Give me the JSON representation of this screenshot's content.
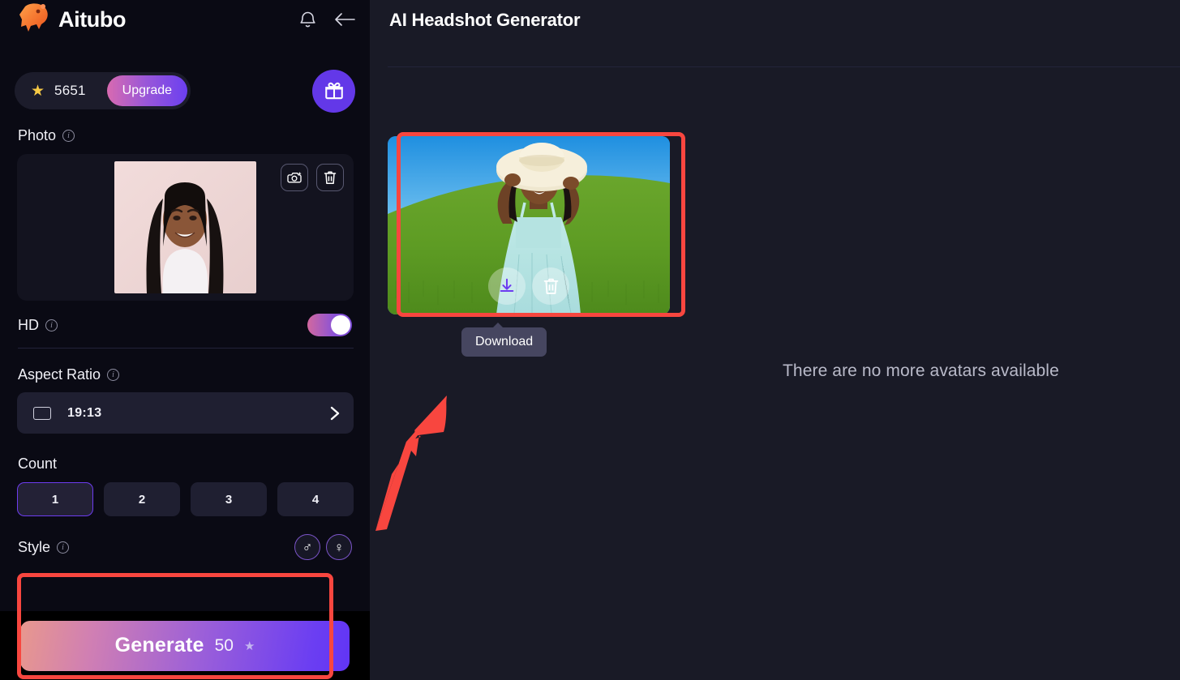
{
  "sidebar": {
    "brand": "Aitubo",
    "logo_icon": "capybara-logo",
    "header_icons": [
      {
        "name": "notification-bell-icon",
        "label": "Notifications"
      },
      {
        "name": "back-arrow-icon",
        "label": "Back"
      }
    ],
    "credits": {
      "star_icon": "star-icon",
      "amount": "5651",
      "upgrade_label": "Upgrade"
    },
    "gift": {
      "icon": "gift-icon",
      "label": "Gift"
    },
    "photo": {
      "label": "Photo",
      "info_icon": "info-icon",
      "retake_icon": "camera-sparkle-icon",
      "delete_icon": "trash-icon",
      "thumbnail_alt": "uploaded-headshot-photo"
    },
    "hd": {
      "label": "HD",
      "info_icon": "info-icon",
      "enabled": true
    },
    "aspect_ratio": {
      "label": "Aspect Ratio",
      "info_icon": "info-icon",
      "icon": "rectangle-icon",
      "value": "19:13",
      "chevron_icon": "chevron-right-icon"
    },
    "count": {
      "label": "Count",
      "options": [
        "1",
        "2",
        "3",
        "4"
      ],
      "selected": "1"
    },
    "style": {
      "label": "Style",
      "info_icon": "info-icon",
      "gender_options": [
        {
          "name": "gender-male-button",
          "glyph": "♂"
        },
        {
          "name": "gender-female-button",
          "glyph": "♀"
        }
      ]
    },
    "generate": {
      "label": "Generate",
      "cost": "50",
      "star_icon": "star-icon"
    }
  },
  "main": {
    "title": "AI Headshot Generator",
    "result": {
      "alt": "generated-avatar-woman-in-hat-in-grass-field",
      "download_icon": "download-icon",
      "delete_icon": "trash-icon"
    },
    "tooltip": "Download",
    "empty_message": "There are no more avatars available"
  },
  "annotations": {
    "color": "#f8463f",
    "highlight_image_box": "generated-image-highlight",
    "highlight_generate_box": "generate-button-highlight",
    "arrow": "arrow-pointing-to-generated-image"
  },
  "colors": {
    "accent_purple": "#6338e8",
    "sidebar_bg": "#0a0a14",
    "main_bg": "#191a26",
    "annotation_red": "#f8463f",
    "credit_star": "#f6c945"
  }
}
